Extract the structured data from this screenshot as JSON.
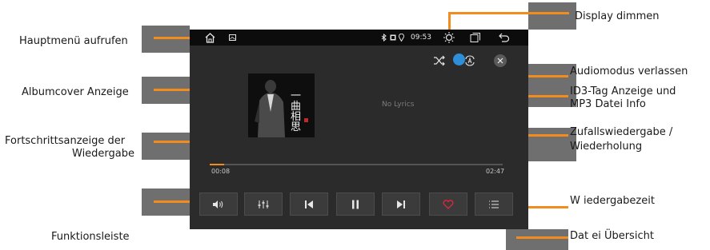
{
  "callouts": {
    "main_menu": "Hauptmenü aufrufen",
    "album_cover": "Albumcover Anzeige",
    "progress_line1": "Fortschrittsanzeige der",
    "progress_line2": "Wiedergabe",
    "function_bar": "Funktionsleiste",
    "display_dim": "Display dimmen",
    "audio_exit": "Audiomodus verlassen",
    "id3_line1": "ID3-Tag Anzeige und",
    "id3_line2": "MP3 Datei Info",
    "shuffle_line1": "Zufallswiedergabe /",
    "shuffle_line2": "Wiederholung",
    "playtime": "W iedergabezeit",
    "file_overview": "Dat ei Übersicht"
  },
  "status_bar": {
    "time": "09:53"
  },
  "player": {
    "lyrics_placeholder": "No Lyrics",
    "elapsed": "00:08",
    "total": "02:47",
    "progress_fraction": 0.05,
    "album_title_chars": "一曲相思"
  },
  "colors": {
    "accent_orange": "#f28c1c",
    "callout_gray": "#6f6f6f",
    "toggle_blue": "#2e8fd8",
    "heart_red": "#e0283c",
    "screen_bg": "#2b2b2b"
  },
  "icons": {
    "home": "home-icon",
    "gallery": "gallery-icon",
    "bluetooth": "bluetooth-icon",
    "sim": "sim-icon",
    "location": "location-icon",
    "brightness": "brightness-icon",
    "recents": "recent-apps-icon",
    "back": "back-icon",
    "shuffle": "shuffle-icon",
    "repeat": "repeat-toggle-icon",
    "close": "close-icon",
    "volume": "volume-icon",
    "equalizer": "equalizer-icon",
    "previous": "previous-track-icon",
    "pause": "pause-icon",
    "next": "next-track-icon",
    "favorite": "heart-icon",
    "playlist": "playlist-icon"
  }
}
